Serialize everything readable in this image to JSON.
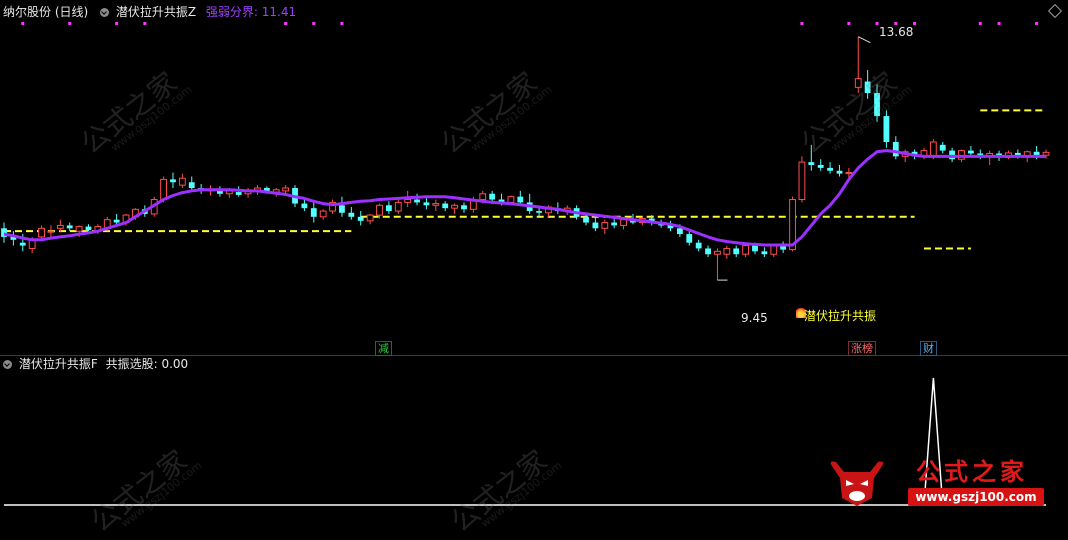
{
  "header": {
    "stock": "纳尔股份 (日线)",
    "indicator": "潜伏拉升共振Z",
    "param_label": "强弱分界:",
    "param_value": "11.41"
  },
  "sub_header": {
    "indicator": "潜伏拉升共振F",
    "param_label": "共振选股:",
    "param_value": "0.00"
  },
  "annotations": {
    "high": "13.68",
    "low": "9.45",
    "signal": "潜伏拉升共振"
  },
  "badges": [
    {
      "text": "减",
      "color": "#2ecc40"
    },
    {
      "text": "涨榜",
      "color": "#ff6b6b"
    },
    {
      "text": "财",
      "color": "#5ab0ff"
    }
  ],
  "watermark": {
    "title": "公式之家",
    "url": "www.gszj100.com"
  },
  "colors": {
    "up": "#ff4d4d",
    "down": "#54ffff",
    "ma": "#9b30ff",
    "support": "#ffff33",
    "signal_line": "#ffffff",
    "dots": "#ff33ff"
  },
  "chart_data": {
    "type": "candlestick",
    "title": "纳尔股份 (日线)",
    "ylim": [
      9.0,
      13.9
    ],
    "candles": [
      {
        "o": 10.35,
        "h": 10.45,
        "l": 10.1,
        "c": 10.2
      },
      {
        "o": 10.2,
        "h": 10.3,
        "l": 10.05,
        "c": 10.15
      },
      {
        "o": 10.1,
        "h": 10.25,
        "l": 9.95,
        "c": 10.05
      },
      {
        "o": 10.0,
        "h": 10.2,
        "l": 9.92,
        "c": 10.15
      },
      {
        "o": 10.2,
        "h": 10.4,
        "l": 10.15,
        "c": 10.35
      },
      {
        "o": 10.3,
        "h": 10.4,
        "l": 10.2,
        "c": 10.3
      },
      {
        "o": 10.35,
        "h": 10.5,
        "l": 10.28,
        "c": 10.4
      },
      {
        "o": 10.4,
        "h": 10.45,
        "l": 10.3,
        "c": 10.35
      },
      {
        "o": 10.3,
        "h": 10.4,
        "l": 10.2,
        "c": 10.38
      },
      {
        "o": 10.38,
        "h": 10.42,
        "l": 10.3,
        "c": 10.32
      },
      {
        "o": 10.3,
        "h": 10.42,
        "l": 10.25,
        "c": 10.38
      },
      {
        "o": 10.35,
        "h": 10.55,
        "l": 10.3,
        "c": 10.5
      },
      {
        "o": 10.5,
        "h": 10.6,
        "l": 10.4,
        "c": 10.45
      },
      {
        "o": 10.45,
        "h": 10.6,
        "l": 10.4,
        "c": 10.58
      },
      {
        "o": 10.55,
        "h": 10.7,
        "l": 10.5,
        "c": 10.68
      },
      {
        "o": 10.68,
        "h": 10.75,
        "l": 10.55,
        "c": 10.6
      },
      {
        "o": 10.6,
        "h": 10.9,
        "l": 10.55,
        "c": 10.85
      },
      {
        "o": 10.85,
        "h": 11.25,
        "l": 10.8,
        "c": 11.2
      },
      {
        "o": 11.2,
        "h": 11.32,
        "l": 11.05,
        "c": 11.15
      },
      {
        "o": 11.1,
        "h": 11.3,
        "l": 11.05,
        "c": 11.22
      },
      {
        "o": 11.15,
        "h": 11.25,
        "l": 11.0,
        "c": 11.05
      },
      {
        "o": 11.05,
        "h": 11.12,
        "l": 10.95,
        "c": 11.0
      },
      {
        "o": 11.0,
        "h": 11.1,
        "l": 10.92,
        "c": 11.02
      },
      {
        "o": 11.0,
        "h": 11.08,
        "l": 10.9,
        "c": 10.95
      },
      {
        "o": 10.95,
        "h": 11.05,
        "l": 10.88,
        "c": 11.0
      },
      {
        "o": 10.98,
        "h": 11.08,
        "l": 10.9,
        "c": 10.93
      },
      {
        "o": 10.95,
        "h": 11.05,
        "l": 10.88,
        "c": 11.0
      },
      {
        "o": 11.0,
        "h": 11.1,
        "l": 10.93,
        "c": 11.05
      },
      {
        "o": 11.05,
        "h": 11.08,
        "l": 10.95,
        "c": 10.98
      },
      {
        "o": 10.98,
        "h": 11.05,
        "l": 10.9,
        "c": 11.02
      },
      {
        "o": 11.0,
        "h": 11.1,
        "l": 10.95,
        "c": 11.05
      },
      {
        "o": 11.05,
        "h": 11.1,
        "l": 10.72,
        "c": 10.78
      },
      {
        "o": 10.78,
        "h": 10.85,
        "l": 10.65,
        "c": 10.7
      },
      {
        "o": 10.7,
        "h": 10.8,
        "l": 10.45,
        "c": 10.55
      },
      {
        "o": 10.55,
        "h": 10.68,
        "l": 10.5,
        "c": 10.65
      },
      {
        "o": 10.65,
        "h": 10.85,
        "l": 10.6,
        "c": 10.8
      },
      {
        "o": 10.75,
        "h": 10.9,
        "l": 10.55,
        "c": 10.62
      },
      {
        "o": 10.62,
        "h": 10.72,
        "l": 10.5,
        "c": 10.55
      },
      {
        "o": 10.55,
        "h": 10.65,
        "l": 10.4,
        "c": 10.48
      },
      {
        "o": 10.48,
        "h": 10.6,
        "l": 10.42,
        "c": 10.58
      },
      {
        "o": 10.58,
        "h": 10.78,
        "l": 10.52,
        "c": 10.75
      },
      {
        "o": 10.75,
        "h": 10.82,
        "l": 10.6,
        "c": 10.65
      },
      {
        "o": 10.65,
        "h": 10.85,
        "l": 10.6,
        "c": 10.8
      },
      {
        "o": 10.8,
        "h": 11.0,
        "l": 10.72,
        "c": 10.85
      },
      {
        "o": 10.85,
        "h": 10.95,
        "l": 10.75,
        "c": 10.8
      },
      {
        "o": 10.8,
        "h": 10.88,
        "l": 10.68,
        "c": 10.75
      },
      {
        "o": 10.75,
        "h": 10.85,
        "l": 10.65,
        "c": 10.78
      },
      {
        "o": 10.78,
        "h": 10.82,
        "l": 10.65,
        "c": 10.7
      },
      {
        "o": 10.7,
        "h": 10.78,
        "l": 10.6,
        "c": 10.75
      },
      {
        "o": 10.75,
        "h": 10.8,
        "l": 10.62,
        "c": 10.68
      },
      {
        "o": 10.68,
        "h": 10.9,
        "l": 10.62,
        "c": 10.85
      },
      {
        "o": 10.85,
        "h": 11.0,
        "l": 10.78,
        "c": 10.95
      },
      {
        "o": 10.95,
        "h": 11.0,
        "l": 10.8,
        "c": 10.85
      },
      {
        "o": 10.85,
        "h": 10.95,
        "l": 10.75,
        "c": 10.8
      },
      {
        "o": 10.8,
        "h": 10.92,
        "l": 10.75,
        "c": 10.9
      },
      {
        "o": 10.9,
        "h": 11.0,
        "l": 10.75,
        "c": 10.8
      },
      {
        "o": 10.8,
        "h": 10.95,
        "l": 10.6,
        "c": 10.65
      },
      {
        "o": 10.65,
        "h": 10.75,
        "l": 10.55,
        "c": 10.62
      },
      {
        "o": 10.62,
        "h": 10.75,
        "l": 10.55,
        "c": 10.72
      },
      {
        "o": 10.7,
        "h": 10.8,
        "l": 10.6,
        "c": 10.65
      },
      {
        "o": 10.65,
        "h": 10.75,
        "l": 10.58,
        "c": 10.7
      },
      {
        "o": 10.7,
        "h": 10.75,
        "l": 10.5,
        "c": 10.55
      },
      {
        "o": 10.55,
        "h": 10.62,
        "l": 10.4,
        "c": 10.45
      },
      {
        "o": 10.45,
        "h": 10.55,
        "l": 10.3,
        "c": 10.35
      },
      {
        "o": 10.35,
        "h": 10.5,
        "l": 10.25,
        "c": 10.45
      },
      {
        "o": 10.45,
        "h": 10.55,
        "l": 10.35,
        "c": 10.4
      },
      {
        "o": 10.4,
        "h": 10.52,
        "l": 10.33,
        "c": 10.5
      },
      {
        "o": 10.5,
        "h": 10.6,
        "l": 10.42,
        "c": 10.45
      },
      {
        "o": 10.45,
        "h": 10.55,
        "l": 10.4,
        "c": 10.52
      },
      {
        "o": 10.52,
        "h": 10.58,
        "l": 10.4,
        "c": 10.45
      },
      {
        "o": 10.45,
        "h": 10.5,
        "l": 10.36,
        "c": 10.4
      },
      {
        "o": 10.4,
        "h": 10.48,
        "l": 10.3,
        "c": 10.35
      },
      {
        "o": 10.35,
        "h": 10.42,
        "l": 10.2,
        "c": 10.25
      },
      {
        "o": 10.25,
        "h": 10.3,
        "l": 10.05,
        "c": 10.1
      },
      {
        "o": 10.1,
        "h": 10.15,
        "l": 9.95,
        "c": 10.0
      },
      {
        "o": 10.0,
        "h": 10.05,
        "l": 9.85,
        "c": 9.9
      },
      {
        "o": 9.9,
        "h": 10.0,
        "l": 9.45,
        "c": 9.95
      },
      {
        "o": 9.9,
        "h": 10.05,
        "l": 9.82,
        "c": 10.0
      },
      {
        "o": 10.0,
        "h": 10.05,
        "l": 9.85,
        "c": 9.9
      },
      {
        "o": 9.9,
        "h": 10.1,
        "l": 9.85,
        "c": 10.05
      },
      {
        "o": 10.05,
        "h": 10.1,
        "l": 9.9,
        "c": 9.95
      },
      {
        "o": 9.95,
        "h": 10.02,
        "l": 9.85,
        "c": 9.9
      },
      {
        "o": 9.9,
        "h": 10.08,
        "l": 9.85,
        "c": 10.05
      },
      {
        "o": 10.05,
        "h": 10.12,
        "l": 9.92,
        "c": 9.98
      },
      {
        "o": 9.98,
        "h": 10.9,
        "l": 9.95,
        "c": 10.85
      },
      {
        "o": 10.85,
        "h": 11.6,
        "l": 10.8,
        "c": 11.5
      },
      {
        "o": 11.5,
        "h": 11.8,
        "l": 11.35,
        "c": 11.45
      },
      {
        "o": 11.45,
        "h": 11.55,
        "l": 11.35,
        "c": 11.4
      },
      {
        "o": 11.4,
        "h": 11.5,
        "l": 11.3,
        "c": 11.35
      },
      {
        "o": 11.35,
        "h": 11.45,
        "l": 11.25,
        "c": 11.3
      },
      {
        "o": 11.3,
        "h": 11.4,
        "l": 11.2,
        "c": 11.32
      },
      {
        "o": 12.8,
        "h": 13.68,
        "l": 12.7,
        "c": 12.95
      },
      {
        "o": 12.9,
        "h": 13.1,
        "l": 12.6,
        "c": 12.7
      },
      {
        "o": 12.7,
        "h": 12.85,
        "l": 12.2,
        "c": 12.3
      },
      {
        "o": 12.3,
        "h": 12.4,
        "l": 11.75,
        "c": 11.85
      },
      {
        "o": 11.85,
        "h": 11.95,
        "l": 11.55,
        "c": 11.6
      },
      {
        "o": 11.6,
        "h": 11.72,
        "l": 11.5,
        "c": 11.68
      },
      {
        "o": 11.68,
        "h": 11.72,
        "l": 11.55,
        "c": 11.6
      },
      {
        "o": 11.6,
        "h": 11.75,
        "l": 11.55,
        "c": 11.7
      },
      {
        "o": 11.6,
        "h": 11.9,
        "l": 11.55,
        "c": 11.85
      },
      {
        "o": 11.8,
        "h": 11.85,
        "l": 11.65,
        "c": 11.7
      },
      {
        "o": 11.7,
        "h": 11.75,
        "l": 11.5,
        "c": 11.55
      },
      {
        "o": 11.55,
        "h": 11.72,
        "l": 11.5,
        "c": 11.7
      },
      {
        "o": 11.7,
        "h": 11.78,
        "l": 11.6,
        "c": 11.65
      },
      {
        "o": 11.65,
        "h": 11.72,
        "l": 11.55,
        "c": 11.6
      },
      {
        "o": 11.6,
        "h": 11.7,
        "l": 11.45,
        "c": 11.65
      },
      {
        "o": 11.65,
        "h": 11.7,
        "l": 11.52,
        "c": 11.58
      },
      {
        "o": 11.58,
        "h": 11.7,
        "l": 11.55,
        "c": 11.66
      },
      {
        "o": 11.66,
        "h": 11.72,
        "l": 11.56,
        "c": 11.6
      },
      {
        "o": 11.6,
        "h": 11.7,
        "l": 11.5,
        "c": 11.68
      },
      {
        "o": 11.68,
        "h": 11.78,
        "l": 11.55,
        "c": 11.62
      },
      {
        "o": 11.62,
        "h": 11.72,
        "l": 11.56,
        "c": 11.67
      }
    ],
    "ma": [
      10.25,
      10.22,
      10.18,
      10.15,
      10.15,
      10.18,
      10.2,
      10.22,
      10.25,
      10.27,
      10.3,
      10.35,
      10.4,
      10.45,
      10.55,
      10.65,
      10.75,
      10.85,
      10.92,
      10.97,
      11.0,
      11.02,
      11.02,
      11.02,
      11.02,
      11.01,
      11.0,
      11.0,
      10.98,
      10.96,
      10.94,
      10.9,
      10.87,
      10.82,
      10.78,
      10.76,
      10.78,
      10.8,
      10.82,
      10.83,
      10.85,
      10.86,
      10.87,
      10.88,
      10.89,
      10.9,
      10.9,
      10.9,
      10.88,
      10.86,
      10.84,
      10.82,
      10.8,
      10.79,
      10.78,
      10.76,
      10.74,
      10.72,
      10.7,
      10.68,
      10.65,
      10.62,
      10.6,
      10.58,
      10.56,
      10.54,
      10.52,
      10.5,
      10.48,
      10.46,
      10.44,
      10.42,
      10.38,
      10.32,
      10.26,
      10.2,
      10.15,
      10.12,
      10.1,
      10.08,
      10.07,
      10.06,
      10.06,
      10.06,
      10.06,
      10.2,
      10.4,
      10.6,
      10.75,
      10.95,
      11.2,
      11.4,
      11.55,
      11.68,
      11.7,
      11.68,
      11.65,
      11.62,
      11.6,
      11.6,
      11.6,
      11.6,
      11.6,
      11.6,
      11.6,
      11.6,
      11.6,
      11.6,
      11.6,
      11.6,
      11.6,
      11.6,
      11.6,
      11.6
    ],
    "support_lines": [
      {
        "x0": 0,
        "x1": 37,
        "y": 10.3
      },
      {
        "x0": 38,
        "x1": 97,
        "y": 10.55
      },
      {
        "x0": 98,
        "x1": 103,
        "y": 10.0
      },
      {
        "x0": 104,
        "x1": 128,
        "y": 12.4
      }
    ],
    "signal_series": {
      "name": "共振选股",
      "values": [
        0,
        0,
        0,
        0,
        0,
        0,
        0,
        0,
        0,
        0,
        0,
        0,
        0,
        0,
        0,
        0,
        0,
        0,
        0,
        0,
        0,
        0,
        0,
        0,
        0,
        0,
        0,
        0,
        0,
        0,
        0,
        0,
        0,
        0,
        0,
        0,
        0,
        0,
        0,
        0,
        0,
        0,
        0,
        0,
        0,
        0,
        0,
        0,
        0,
        0,
        0,
        0,
        0,
        0,
        0,
        0,
        0,
        0,
        0,
        0,
        0,
        0,
        0,
        0,
        0,
        0,
        0,
        0,
        0,
        0,
        0,
        0,
        0,
        0,
        0,
        0,
        0,
        0,
        0,
        0,
        0,
        0,
        0,
        0,
        0,
        0,
        0,
        0,
        0,
        0,
        0,
        0,
        0,
        0,
        0,
        0,
        0,
        0,
        0,
        1,
        0,
        0,
        0,
        0,
        0,
        0,
        0,
        0,
        0,
        0,
        0,
        0,
        0,
        0,
        0,
        0,
        0,
        0,
        0,
        0,
        0,
        0,
        0,
        0,
        0,
        0,
        0,
        0,
        0
      ],
      "ylim": [
        0,
        1
      ]
    }
  }
}
